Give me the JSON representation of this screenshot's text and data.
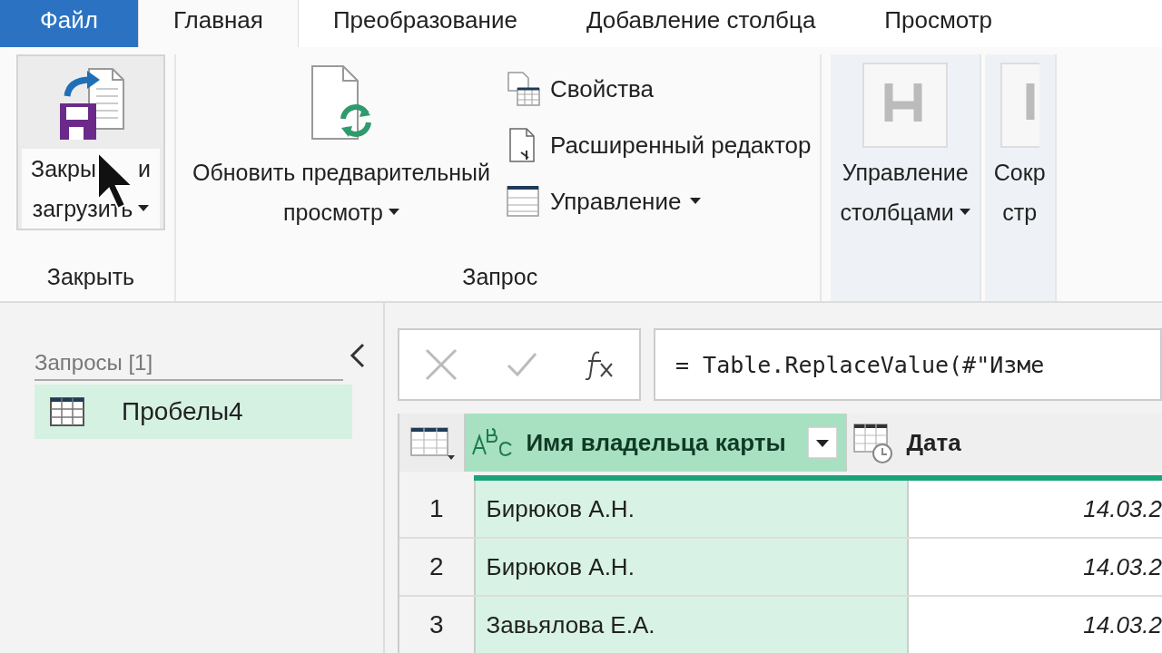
{
  "tabs": [
    {
      "label": "Файл",
      "kind": "file",
      "selected": false
    },
    {
      "label": "Главная",
      "kind": "tab",
      "selected": true
    },
    {
      "label": "Преобразование",
      "kind": "tab",
      "selected": false
    },
    {
      "label": "Добавление столбца",
      "kind": "tab",
      "selected": false
    },
    {
      "label": "Просмотр",
      "kind": "tab",
      "selected": false
    }
  ],
  "ribbon": {
    "groups": [
      {
        "label": "Закрыть",
        "big_buttons": [
          {
            "kind": "close-load",
            "lines": [
              [
                "Закры",
                "и"
              ],
              [
                "загрузить"
              ]
            ],
            "dropdown": true
          }
        ]
      },
      {
        "label": "Запрос",
        "big_buttons": [
          {
            "kind": "refresh",
            "lines": [
              [
                "Обновить предварительный"
              ],
              [
                "просмотр"
              ]
            ],
            "dropdown": true
          }
        ],
        "small_buttons": [
          {
            "kind": "properties",
            "label": "Свойства",
            "dropdown": false
          },
          {
            "kind": "editor",
            "label": "Расширенный редактор",
            "dropdown": false
          },
          {
            "kind": "manage",
            "label": "Управление",
            "dropdown": true
          }
        ]
      },
      {
        "shaded": true,
        "big_buttons": [
          {
            "kind": "columns",
            "lines": [
              [
                "Управление"
              ],
              [
                "столбцами"
              ]
            ],
            "dropdown": true
          }
        ]
      },
      {
        "shaded": true,
        "big_buttons": [
          {
            "kind": "rows",
            "lines": [
              [
                "Сокр"
              ],
              [
                "стр"
              ]
            ],
            "dropdown": false
          }
        ]
      }
    ]
  },
  "queries": {
    "title": "Запросы [1]",
    "items": [
      {
        "name": "Пробелы4",
        "selected": true
      }
    ]
  },
  "formula_bar": {
    "formula": "= Table.ReplaceValue(#\"Изме"
  },
  "table": {
    "columns": [
      {
        "kind": "text",
        "name": "Имя владельца карты",
        "selected": true
      },
      {
        "kind": "date",
        "name": "Дата",
        "selected": false
      }
    ],
    "rows": [
      {
        "index": "1",
        "cells": [
          "Бирюков А.Н.",
          "14.03.2"
        ]
      },
      {
        "index": "2",
        "cells": [
          "Бирюков А.Н.",
          "14.03.2"
        ]
      },
      {
        "index": "3",
        "cells": [
          "Завьялова Е.А.",
          "14.03.2"
        ]
      }
    ]
  }
}
